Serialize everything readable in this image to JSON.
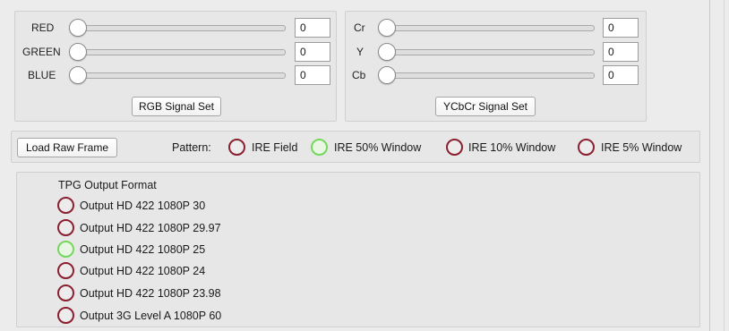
{
  "rgb": {
    "sliders": [
      {
        "label": "RED",
        "value": "0"
      },
      {
        "label": "GREEN",
        "value": "0"
      },
      {
        "label": "BLUE",
        "value": "0"
      }
    ],
    "button_label": "RGB Signal Set"
  },
  "ycbcr": {
    "sliders": [
      {
        "label": "Cr",
        "value": "0"
      },
      {
        "label": "Y",
        "value": "0"
      },
      {
        "label": "Cb",
        "value": "0"
      }
    ],
    "button_label": "YCbCr Signal Set"
  },
  "pattern_bar": {
    "load_button": "Load Raw Frame",
    "label": "Pattern:",
    "options": [
      {
        "label": "IRE Field",
        "selected": false
      },
      {
        "label": "IRE 50% Window",
        "selected": true
      },
      {
        "label": "IRE 10% Window",
        "selected": false
      },
      {
        "label": "IRE 5% Window",
        "selected": false
      }
    ]
  },
  "tpg": {
    "title": "TPG Output Format",
    "options": [
      {
        "label": "Output HD 422 1080P 30",
        "selected": false
      },
      {
        "label": "Output HD 422 1080P 29.97",
        "selected": false
      },
      {
        "label": "Output HD 422 1080P 25",
        "selected": true
      },
      {
        "label": "Output HD 422 1080P 24",
        "selected": false
      },
      {
        "label": "Output HD 422 1080P 23.98",
        "selected": false
      },
      {
        "label": "Output 3G Level A 1080P 60",
        "selected": false
      }
    ]
  },
  "colors": {
    "radio_off": "#8a1f30",
    "radio_on": "#74d85c"
  }
}
